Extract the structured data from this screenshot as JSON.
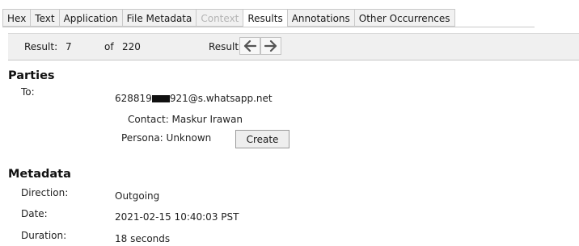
{
  "tabs": [
    {
      "label": "Hex",
      "state": "normal"
    },
    {
      "label": "Text",
      "state": "normal"
    },
    {
      "label": "Application",
      "state": "normal"
    },
    {
      "label": "File Metadata",
      "state": "normal"
    },
    {
      "label": "Context",
      "state": "disabled"
    },
    {
      "label": "Results",
      "state": "active"
    },
    {
      "label": "Annotations",
      "state": "normal"
    },
    {
      "label": "Other Occurrences",
      "state": "normal"
    }
  ],
  "result_bar": {
    "result_label": "Result:",
    "result_index": "7",
    "of_label": "of",
    "result_total": "220",
    "result_nav_label": "Result",
    "prev_icon": "arrow-left-icon",
    "next_icon": "arrow-right-icon"
  },
  "parties": {
    "title": "Parties",
    "to_label": "To:",
    "to_prefix": "628819",
    "to_suffix": "921@s.whatsapp.net",
    "contact": "Contact: Maskur Irawan",
    "persona": "Persona: Unknown",
    "create_label": "Create"
  },
  "metadata": {
    "title": "Metadata",
    "direction_label": "Direction:",
    "direction_value": "Outgoing",
    "date_label": "Date:",
    "date_value": "2021-02-15 10:40:03 PST",
    "duration_label": "Duration:",
    "duration_value": "18 seconds"
  }
}
